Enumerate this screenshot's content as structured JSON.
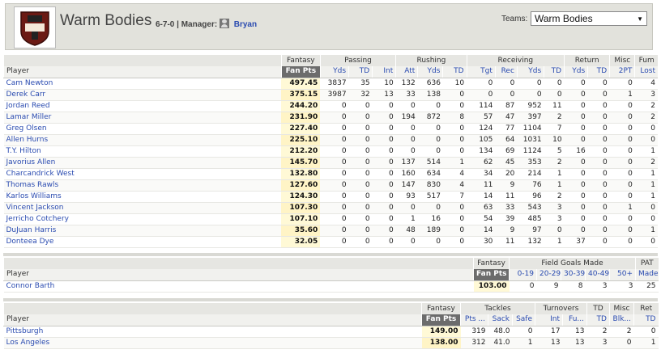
{
  "header": {
    "team_name": "Warm Bodies",
    "record": "6-7-0",
    "manager_label": "Manager:",
    "manager_name": "Bryan",
    "teams_label": "Teams:",
    "teams_selected": "Warm Bodies",
    "logo_icon": "team-logo-icon",
    "manager_icon": "user-icon"
  },
  "offense": {
    "groups": [
      "Fantasy",
      "Passing",
      "Rushing",
      "Receiving",
      "Return",
      "Misc",
      "Fum"
    ],
    "player_header": "Player",
    "columns": [
      "Fan Pts",
      "Yds",
      "TD",
      "Int",
      "Att",
      "Yds",
      "TD",
      "Tgt",
      "Rec",
      "Yds",
      "TD",
      "Yds",
      "TD",
      "2PT",
      "Lost"
    ],
    "rows": [
      {
        "name": "Cam Newton",
        "pts": "497.45",
        "stats": [
          "3837",
          "35",
          "10",
          "132",
          "636",
          "10",
          "0",
          "0",
          "0",
          "0",
          "0",
          "0",
          "0",
          "4"
        ]
      },
      {
        "name": "Derek Carr",
        "pts": "375.15",
        "stats": [
          "3987",
          "32",
          "13",
          "33",
          "138",
          "0",
          "0",
          "0",
          "0",
          "0",
          "0",
          "0",
          "1",
          "3"
        ]
      },
      {
        "name": "Jordan Reed",
        "pts": "244.20",
        "stats": [
          "0",
          "0",
          "0",
          "0",
          "0",
          "0",
          "114",
          "87",
          "952",
          "11",
          "0",
          "0",
          "0",
          "2"
        ]
      },
      {
        "name": "Lamar Miller",
        "pts": "231.90",
        "stats": [
          "0",
          "0",
          "0",
          "194",
          "872",
          "8",
          "57",
          "47",
          "397",
          "2",
          "0",
          "0",
          "0",
          "2"
        ]
      },
      {
        "name": "Greg Olsen",
        "pts": "227.40",
        "stats": [
          "0",
          "0",
          "0",
          "0",
          "0",
          "0",
          "124",
          "77",
          "1104",
          "7",
          "0",
          "0",
          "0",
          "0"
        ]
      },
      {
        "name": "Allen Hurns",
        "pts": "225.10",
        "stats": [
          "0",
          "0",
          "0",
          "0",
          "0",
          "0",
          "105",
          "64",
          "1031",
          "10",
          "0",
          "0",
          "0",
          "0"
        ]
      },
      {
        "name": "T.Y. Hilton",
        "pts": "212.20",
        "stats": [
          "0",
          "0",
          "0",
          "0",
          "0",
          "0",
          "134",
          "69",
          "1124",
          "5",
          "16",
          "0",
          "0",
          "1"
        ]
      },
      {
        "name": "Javorius Allen",
        "pts": "145.70",
        "stats": [
          "0",
          "0",
          "0",
          "137",
          "514",
          "1",
          "62",
          "45",
          "353",
          "2",
          "0",
          "0",
          "0",
          "2"
        ]
      },
      {
        "name": "Charcandrick West",
        "pts": "132.80",
        "stats": [
          "0",
          "0",
          "0",
          "160",
          "634",
          "4",
          "34",
          "20",
          "214",
          "1",
          "0",
          "0",
          "0",
          "1"
        ]
      },
      {
        "name": "Thomas Rawls",
        "pts": "127.60",
        "stats": [
          "0",
          "0",
          "0",
          "147",
          "830",
          "4",
          "11",
          "9",
          "76",
          "1",
          "0",
          "0",
          "0",
          "1"
        ]
      },
      {
        "name": "Karlos Williams",
        "pts": "124.30",
        "stats": [
          "0",
          "0",
          "0",
          "93",
          "517",
          "7",
          "14",
          "11",
          "96",
          "2",
          "0",
          "0",
          "0",
          "1"
        ]
      },
      {
        "name": "Vincent Jackson",
        "pts": "107.30",
        "stats": [
          "0",
          "0",
          "0",
          "0",
          "0",
          "0",
          "63",
          "33",
          "543",
          "3",
          "0",
          "0",
          "1",
          "0"
        ]
      },
      {
        "name": "Jerricho Cotchery",
        "pts": "107.10",
        "stats": [
          "0",
          "0",
          "0",
          "1",
          "16",
          "0",
          "54",
          "39",
          "485",
          "3",
          "0",
          "0",
          "0",
          "0"
        ]
      },
      {
        "name": "DuJuan Harris",
        "pts": "35.60",
        "stats": [
          "0",
          "0",
          "0",
          "48",
          "189",
          "0",
          "14",
          "9",
          "97",
          "0",
          "0",
          "0",
          "0",
          "1"
        ]
      },
      {
        "name": "Donteea Dye",
        "pts": "32.05",
        "stats": [
          "0",
          "0",
          "0",
          "0",
          "0",
          "0",
          "30",
          "11",
          "132",
          "1",
          "37",
          "0",
          "0",
          "0"
        ]
      }
    ]
  },
  "kicker": {
    "groups": [
      "Fantasy",
      "Field Goals Made",
      "PAT"
    ],
    "player_header": "Player",
    "columns": [
      "Fan Pts",
      "0-19",
      "20-29",
      "30-39",
      "40-49",
      "50+",
      "Made"
    ],
    "rows": [
      {
        "name": "Connor Barth",
        "pts": "103.00",
        "stats": [
          "0",
          "9",
          "8",
          "3",
          "3",
          "25"
        ]
      }
    ]
  },
  "defense": {
    "groups": [
      "Fantasy",
      "Tackles",
      "Turnovers",
      "TD",
      "Misc",
      "Ret"
    ],
    "player_header": "Player",
    "columns": [
      "Fan Pts",
      "Pts ...",
      "Sack",
      "Safe",
      "Int",
      "Fu...",
      "TD",
      "Blk...",
      "TD"
    ],
    "rows": [
      {
        "name": "Pittsburgh",
        "pts": "149.00",
        "stats": [
          "319",
          "48.0",
          "0",
          "17",
          "13",
          "2",
          "2",
          "0"
        ]
      },
      {
        "name": "Los Angeles",
        "pts": "138.00",
        "stats": [
          "312",
          "41.0",
          "1",
          "13",
          "13",
          "3",
          "0",
          "1"
        ]
      }
    ]
  }
}
